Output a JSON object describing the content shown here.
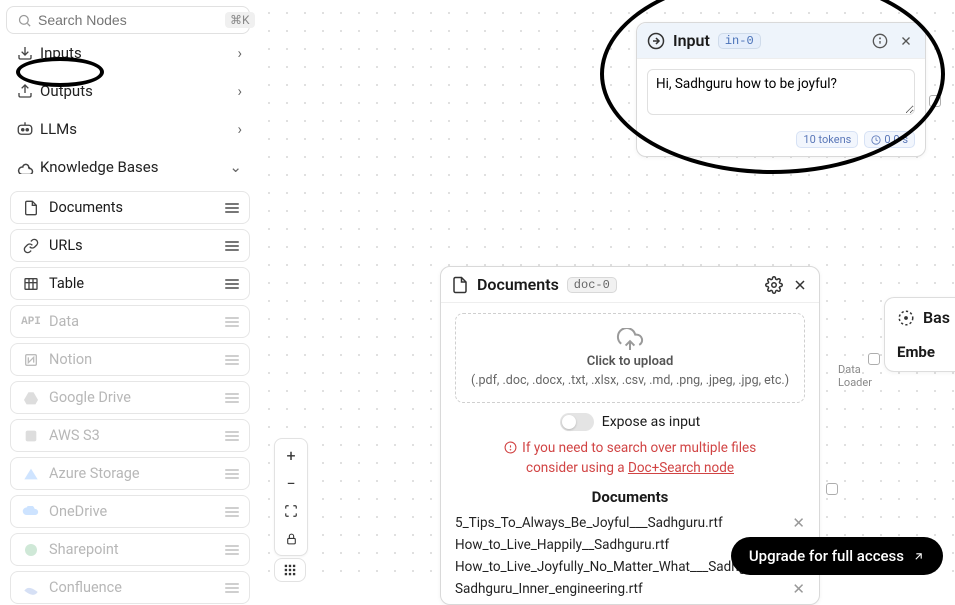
{
  "sidebar": {
    "search_placeholder": "Search Nodes",
    "search_shortcut": "⌘K",
    "categories": [
      {
        "id": "inputs",
        "label": "Inputs",
        "chev": "›"
      },
      {
        "id": "outputs",
        "label": "Outputs",
        "chev": "›"
      },
      {
        "id": "llms",
        "label": "LLMs",
        "chev": "›"
      },
      {
        "id": "kb",
        "label": "Knowledge Bases",
        "chev": "⌄"
      }
    ],
    "kb_items": [
      {
        "id": "documents",
        "label": "Documents",
        "disabled": false
      },
      {
        "id": "urls",
        "label": "URLs",
        "disabled": false
      },
      {
        "id": "table",
        "label": "Table",
        "disabled": false
      },
      {
        "id": "data",
        "label": "Data",
        "disabled": true
      },
      {
        "id": "notion",
        "label": "Notion",
        "disabled": true
      },
      {
        "id": "gdrive",
        "label": "Google Drive",
        "disabled": true
      },
      {
        "id": "aws",
        "label": "AWS S3",
        "disabled": true
      },
      {
        "id": "azure",
        "label": "Azure Storage",
        "disabled": true
      },
      {
        "id": "onedrive",
        "label": "OneDrive",
        "disabled": true
      },
      {
        "id": "sharepoint",
        "label": "Sharepoint",
        "disabled": true
      },
      {
        "id": "confluence",
        "label": "Confluence",
        "disabled": true
      }
    ]
  },
  "input_node": {
    "title": "Input",
    "id_chip": "in-0",
    "text": "Hi, Sadhguru how to be joyful?",
    "tokens_chip": "10 tokens",
    "cost_chip": "0.0 s"
  },
  "doc_node": {
    "title": "Documents",
    "id_chip": "doc-0",
    "upload_title": "Click to upload",
    "upload_sub": "(.pdf, .doc, .docx, .txt, .xlsx, .csv, .md, .png, .jpeg, .jpg, etc.)",
    "expose_label": "Expose as input",
    "warn_line1": "If you need to search over multiple files",
    "warn_line2_prefix": "consider using a  ",
    "warn_link": "Doc+Search node",
    "docs_heading": "Documents",
    "files": [
      "5_Tips_To_Always_Be_Joyful___Sadhguru.rtf",
      "How_to_Live_Happily__Sadhguru.rtf",
      "How_to_Live_Joyfully_No_Matter_What___Sadhgu…",
      "Sadhguru_Inner_engineering.rtf"
    ]
  },
  "data_loader_label_1": "Data",
  "data_loader_label_2": "Loader",
  "peek": {
    "title": "Bas",
    "row2": "Embe"
  },
  "upgrade_label": "Upgrade for full access",
  "zoom": {
    "plus": "+",
    "minus": "−"
  }
}
